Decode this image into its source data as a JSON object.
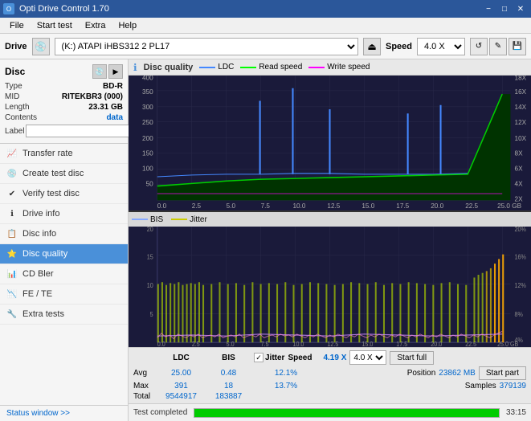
{
  "titlebar": {
    "title": "Opti Drive Control 1.70",
    "minimize": "−",
    "maximize": "□",
    "close": "✕"
  },
  "menubar": {
    "items": [
      "File",
      "Start test",
      "Extra",
      "Help"
    ]
  },
  "drivebar": {
    "label": "Drive",
    "drive_value": "(K:)  ATAPI iHBS312  2 PL17",
    "speed_label": "Speed",
    "speed_value": "4.0 X"
  },
  "disc": {
    "title": "Disc",
    "type_label": "Type",
    "type_value": "BD-R",
    "mid_label": "MID",
    "mid_value": "RITEKBR3 (000)",
    "length_label": "Length",
    "length_value": "23.31 GB",
    "contents_label": "Contents",
    "contents_value": "data",
    "label_label": "Label",
    "label_placeholder": ""
  },
  "nav": {
    "items": [
      {
        "id": "transfer-rate",
        "label": "Transfer rate",
        "icon": "📈"
      },
      {
        "id": "create-test-disc",
        "label": "Create test disc",
        "icon": "💿"
      },
      {
        "id": "verify-test-disc",
        "label": "Verify test disc",
        "icon": "✔"
      },
      {
        "id": "drive-info",
        "label": "Drive info",
        "icon": "ℹ"
      },
      {
        "id": "disc-info",
        "label": "Disc info",
        "icon": "📋"
      },
      {
        "id": "disc-quality",
        "label": "Disc quality",
        "icon": "⭐",
        "active": true
      },
      {
        "id": "cd-bler",
        "label": "CD Bler",
        "icon": "📊"
      },
      {
        "id": "fe-te",
        "label": "FE / TE",
        "icon": "📉"
      },
      {
        "id": "extra-tests",
        "label": "Extra tests",
        "icon": "🔧"
      }
    ],
    "status_window": "Status window >>"
  },
  "chart": {
    "title": "Disc quality",
    "legend": {
      "ldc_label": "LDC",
      "read_label": "Read speed",
      "write_label": "Write speed",
      "bis_label": "BIS",
      "jitter_label": "Jitter"
    },
    "top": {
      "y_max": 400,
      "y_right_max": 18,
      "right_labels": [
        "18X",
        "16X",
        "14X",
        "12X",
        "10X",
        "8X",
        "6X",
        "4X",
        "2X"
      ],
      "left_labels": [
        "400",
        "350",
        "300",
        "250",
        "200",
        "150",
        "100",
        "50"
      ],
      "x_labels": [
        "0.0",
        "2.5",
        "5.0",
        "7.5",
        "10.0",
        "12.5",
        "15.0",
        "17.5",
        "20.0",
        "22.5",
        "25.0 GB"
      ]
    },
    "bottom": {
      "y_max": 20,
      "right_max": 20,
      "right_labels": [
        "20%",
        "16%",
        "12%",
        "8%",
        "4%"
      ],
      "left_labels": [
        "20",
        "15",
        "10",
        "5"
      ],
      "x_labels": [
        "0.0",
        "2.5",
        "5.0",
        "7.5",
        "10.0",
        "12.5",
        "15.0",
        "17.5",
        "20.0",
        "22.5",
        "25.0 GB"
      ]
    }
  },
  "stats": {
    "col_ldc": "LDC",
    "col_bis": "BIS",
    "col_jitter": "Jitter",
    "col_speed": "Speed",
    "avg_label": "Avg",
    "avg_ldc": "25.00",
    "avg_bis": "0.48",
    "avg_jitter": "12.1%",
    "avg_speed": "4.19 X",
    "max_label": "Max",
    "max_ldc": "391",
    "max_bis": "18",
    "max_jitter": "13.7%",
    "position_label": "Position",
    "position_value": "23862 MB",
    "total_label": "Total",
    "total_ldc": "9544917",
    "total_bis": "183887",
    "samples_label": "Samples",
    "samples_value": "379139",
    "speed_select": "4.0 X",
    "btn_full": "Start full",
    "btn_part": "Start part"
  },
  "statusbar": {
    "text": "Test completed",
    "progress": 100,
    "time": "33:15"
  }
}
